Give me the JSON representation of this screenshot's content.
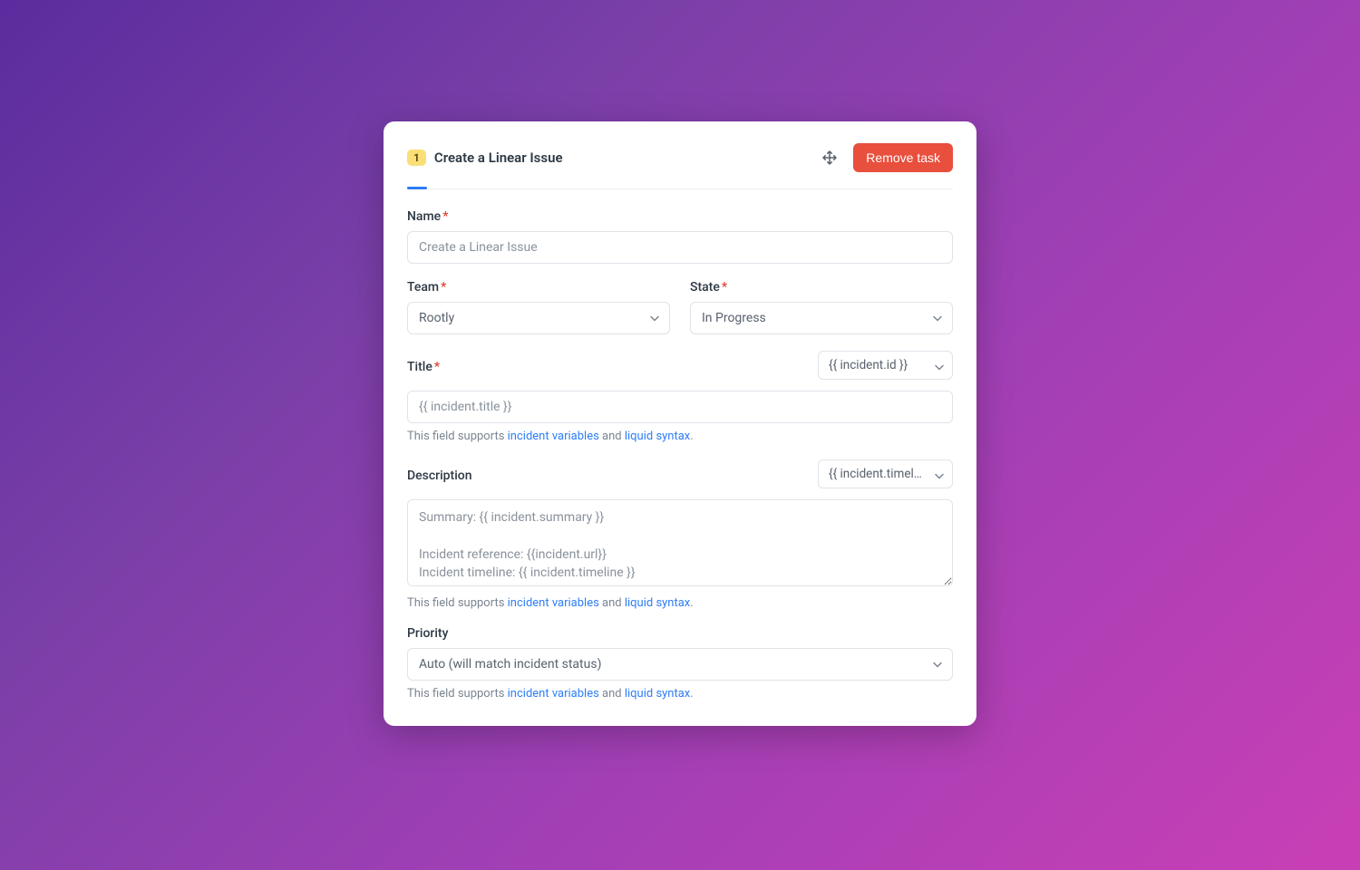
{
  "header": {
    "step_number": "1",
    "title": "Create a Linear Issue",
    "remove_label": "Remove task"
  },
  "fields": {
    "name": {
      "label": "Name",
      "value": "Create a Linear Issue"
    },
    "team": {
      "label": "Team",
      "selected": "Rootly"
    },
    "state": {
      "label": "State",
      "selected": "In Progress"
    },
    "title": {
      "label": "Title",
      "var_selected": "{{ incident.id }}",
      "value": "{{ incident.title }}"
    },
    "description": {
      "label": "Description",
      "var_selected": "{{ incident.timelin…",
      "value": "Summary: {{ incident.summary }}\n\nIncident reference: {{incident.url}}\nIncident timeline: {{ incident.timeline }}"
    },
    "priority": {
      "label": "Priority",
      "selected": "Auto (will match incident status)"
    }
  },
  "hint": {
    "prefix": "This field supports ",
    "link1": "incident variables",
    "mid": " and ",
    "link2": "liquid syntax",
    "suffix": "."
  }
}
